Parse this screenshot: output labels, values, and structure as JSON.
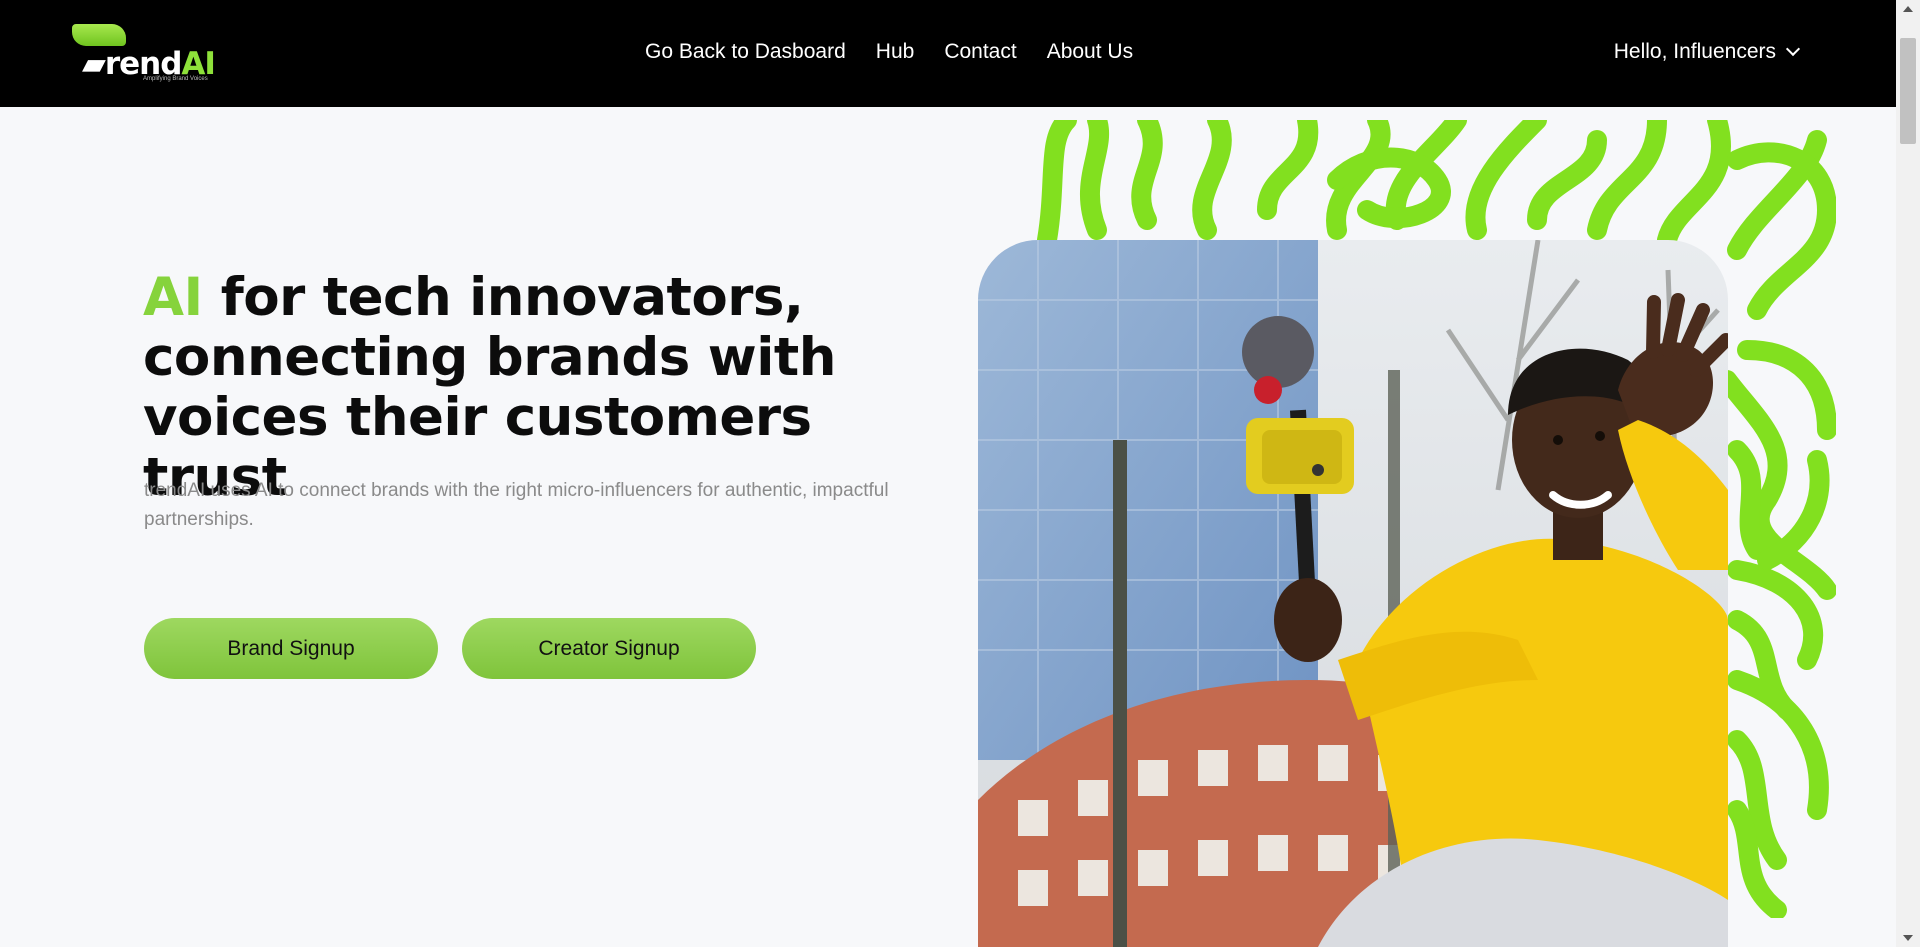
{
  "header": {
    "logo": {
      "word_prefix": "rend",
      "word_accent": "AI",
      "tagline": "Amplifying Brand Voices"
    },
    "nav": [
      {
        "label": "Go Back to Dasboard"
      },
      {
        "label": "Hub"
      },
      {
        "label": "Contact"
      },
      {
        "label": "About Us"
      }
    ],
    "user_menu_label": "Hello, Influencers"
  },
  "hero": {
    "title_accent": "AI",
    "title_rest": " for tech innovators, connecting brands with voices their customers trust",
    "subtitle": "trendAI uses AI to connect brands with the right micro-influencers for authentic, impactful partnerships.",
    "brand_signup_label": "Brand Signup",
    "creator_signup_label": "Creator Signup"
  },
  "colors": {
    "accent": "#86d33c",
    "header_bg": "#000000",
    "page_bg": "#f7f8fa"
  }
}
